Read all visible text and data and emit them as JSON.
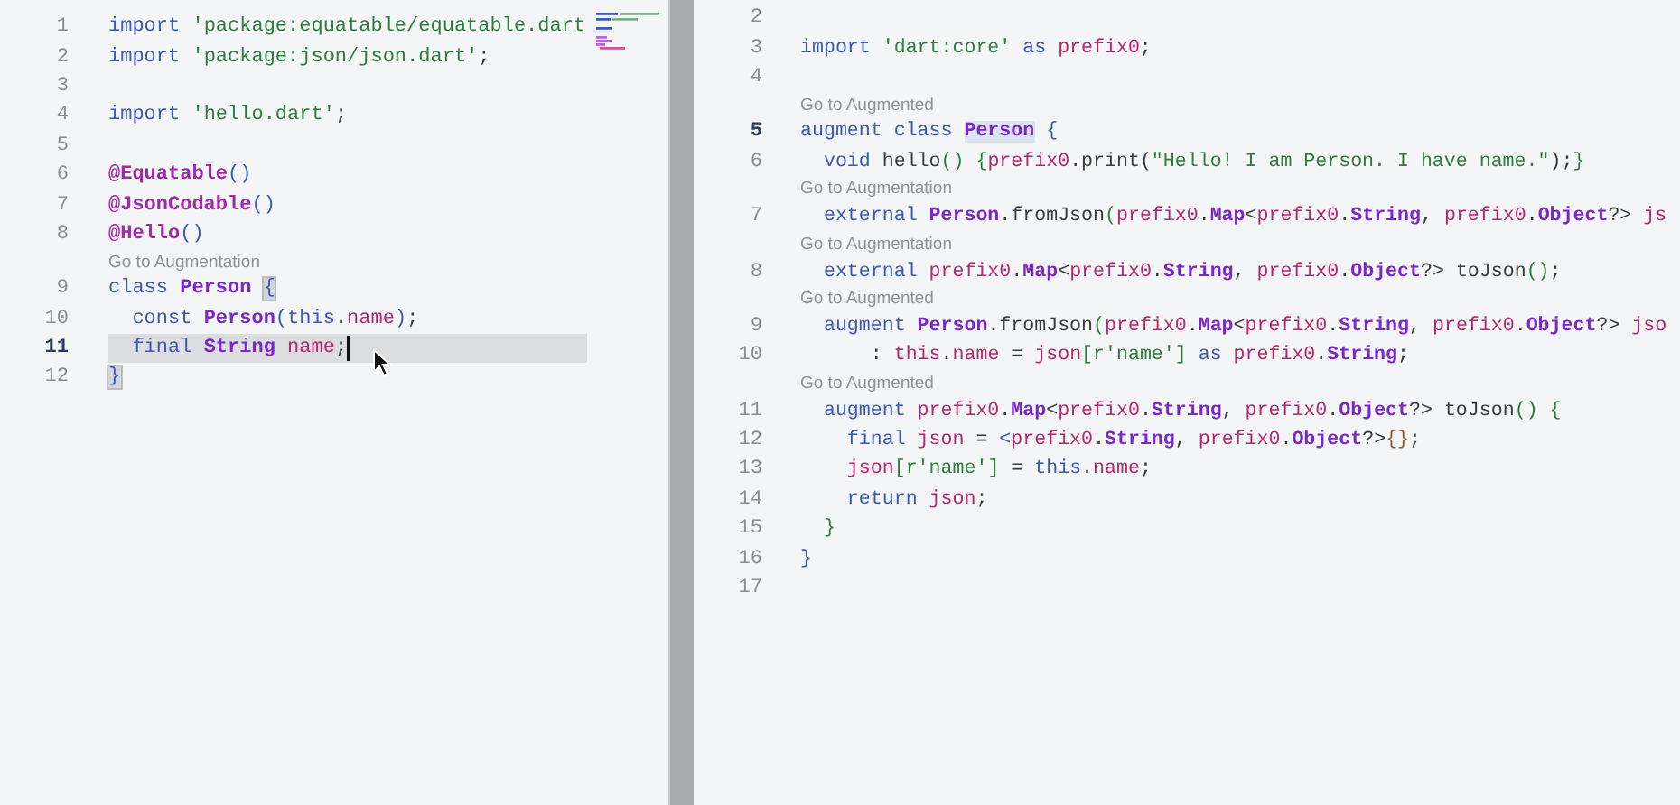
{
  "left_pane": {
    "lines": [
      {
        "kind": "code",
        "number": "1",
        "current": false,
        "highlighted": false,
        "caret": false,
        "tokens": [
          {
            "text": "import ",
            "kind": "kw"
          },
          {
            "text": "'package:equatable/equatable.dart",
            "kind": "str"
          }
        ]
      },
      {
        "kind": "code",
        "number": "2",
        "current": false,
        "highlighted": false,
        "caret": false,
        "tokens": [
          {
            "text": "import ",
            "kind": "kw"
          },
          {
            "text": "'package:json/json.dart'",
            "kind": "str"
          },
          {
            "text": ";",
            "kind": "p"
          }
        ]
      },
      {
        "kind": "code",
        "number": "3",
        "current": false,
        "highlighted": false,
        "caret": false
      },
      {
        "kind": "code",
        "number": "4",
        "current": false,
        "highlighted": false,
        "caret": false,
        "tokens": [
          {
            "text": "import ",
            "kind": "kw"
          },
          {
            "text": "'hello.dart'",
            "kind": "str"
          },
          {
            "text": ";",
            "kind": "p"
          }
        ]
      },
      {
        "kind": "code",
        "number": "5",
        "current": false,
        "highlighted": false,
        "caret": false
      },
      {
        "kind": "code",
        "number": "6",
        "current": false,
        "highlighted": false,
        "caret": false,
        "tokens": [
          {
            "text": "@Equatable",
            "kind": "ann"
          },
          {
            "text": "()",
            "kind": "brk"
          }
        ]
      },
      {
        "kind": "code",
        "number": "7",
        "current": false,
        "highlighted": false,
        "caret": false,
        "tokens": [
          {
            "text": "@JsonCodable",
            "kind": "ann"
          },
          {
            "text": "()",
            "kind": "brk"
          }
        ]
      },
      {
        "kind": "code",
        "number": "8",
        "current": false,
        "highlighted": false,
        "caret": false,
        "tokens": [
          {
            "text": "@Hello",
            "kind": "ann"
          },
          {
            "text": "()",
            "kind": "brk"
          }
        ]
      },
      {
        "kind": "lens",
        "text": "Go to Augmentation"
      },
      {
        "kind": "code",
        "number": "9",
        "current": false,
        "highlighted": false,
        "caret": false,
        "tokens": [
          {
            "text": "class ",
            "kind": "kw"
          },
          {
            "text": "Person ",
            "kind": "type"
          },
          {
            "text": "{",
            "kind": "brk_match"
          }
        ]
      },
      {
        "kind": "code",
        "number": "10",
        "current": false,
        "highlighted": false,
        "caret": false,
        "tokens": [
          {
            "text": "  const ",
            "kind": "kw"
          },
          {
            "text": "Person",
            "kind": "type"
          },
          {
            "text": "(",
            "kind": "brk"
          },
          {
            "text": "this",
            "kind": "kw"
          },
          {
            "text": ".",
            "kind": "p"
          },
          {
            "text": "name",
            "kind": "var"
          },
          {
            "text": ")",
            "kind": "brk"
          },
          {
            "text": ";",
            "kind": "p"
          }
        ]
      },
      {
        "kind": "code",
        "number": "11",
        "current": true,
        "highlighted": true,
        "caret": true,
        "tokens": [
          {
            "text": "  final ",
            "kind": "kw"
          },
          {
            "text": "String",
            "kind": "type"
          },
          {
            "text": " name",
            "kind": "var"
          },
          {
            "text": ";",
            "kind": "p"
          }
        ]
      },
      {
        "kind": "code",
        "number": "12",
        "current": false,
        "highlighted": false,
        "caret": false,
        "tokens": [
          {
            "text": "}",
            "kind": "brk_match"
          }
        ]
      }
    ]
  },
  "right_pane": {
    "lines": [
      {
        "kind": "code",
        "number": "2",
        "current": false
      },
      {
        "kind": "code",
        "number": "3",
        "current": false,
        "tokens": [
          {
            "text": "import ",
            "kind": "kw"
          },
          {
            "text": "'dart:core'",
            "kind": "str"
          },
          {
            "text": " as ",
            "kind": "kw"
          },
          {
            "text": "prefix0",
            "kind": "var"
          },
          {
            "text": ";",
            "kind": "p"
          }
        ]
      },
      {
        "kind": "code",
        "number": "4",
        "current": false
      },
      {
        "kind": "lens",
        "text": "Go to Augmented"
      },
      {
        "kind": "code",
        "number": "5",
        "current": true,
        "tokens": [
          {
            "text": "augment class ",
            "kind": "kw"
          },
          {
            "text": "Person",
            "kind": "type_match"
          },
          {
            "text": " {",
            "kind": "brk"
          }
        ]
      },
      {
        "kind": "code",
        "number": "6",
        "current": false,
        "tokens": [
          {
            "text": "  void",
            "kind": "kw"
          },
          {
            "text": " hello",
            "kind": "p"
          },
          {
            "text": "() {",
            "kind": "brk2"
          },
          {
            "text": "prefix0",
            "kind": "var"
          },
          {
            "text": ".print(",
            "kind": "p"
          },
          {
            "text": "\"Hello! I am Person. I have name.\"",
            "kind": "str"
          },
          {
            "text": ");",
            "kind": "p"
          },
          {
            "text": "}",
            "kind": "brk2"
          }
        ]
      },
      {
        "kind": "lens",
        "text": "Go to Augmentation"
      },
      {
        "kind": "code",
        "number": "7",
        "current": false,
        "tokens": [
          {
            "text": "  external ",
            "kind": "kw"
          },
          {
            "text": "Person",
            "kind": "type"
          },
          {
            "text": ".fromJson",
            "kind": "p"
          },
          {
            "text": "(",
            "kind": "brk2"
          },
          {
            "text": "prefix0",
            "kind": "var"
          },
          {
            "text": ".",
            "kind": "p"
          },
          {
            "text": "Map",
            "kind": "type"
          },
          {
            "text": "<",
            "kind": "p"
          },
          {
            "text": "prefix0",
            "kind": "var"
          },
          {
            "text": ".",
            "kind": "p"
          },
          {
            "text": "String",
            "kind": "type"
          },
          {
            "text": ", ",
            "kind": "p"
          },
          {
            "text": "prefix0",
            "kind": "var"
          },
          {
            "text": ".",
            "kind": "p"
          },
          {
            "text": "Object",
            "kind": "type"
          },
          {
            "text": "?> ",
            "kind": "p"
          },
          {
            "text": "js",
            "kind": "var"
          }
        ]
      },
      {
        "kind": "lens",
        "text": "Go to Augmentation"
      },
      {
        "kind": "code",
        "number": "8",
        "current": false,
        "tokens": [
          {
            "text": "  external ",
            "kind": "kw"
          },
          {
            "text": "prefix0",
            "kind": "var"
          },
          {
            "text": ".",
            "kind": "p"
          },
          {
            "text": "Map",
            "kind": "type"
          },
          {
            "text": "<",
            "kind": "p"
          },
          {
            "text": "prefix0",
            "kind": "var"
          },
          {
            "text": ".",
            "kind": "p"
          },
          {
            "text": "String",
            "kind": "type"
          },
          {
            "text": ", ",
            "kind": "p"
          },
          {
            "text": "prefix0",
            "kind": "var"
          },
          {
            "text": ".",
            "kind": "p"
          },
          {
            "text": "Object",
            "kind": "type"
          },
          {
            "text": "?> toJson",
            "kind": "p"
          },
          {
            "text": "()",
            "kind": "brk2"
          },
          {
            "text": ";",
            "kind": "p"
          }
        ]
      },
      {
        "kind": "lens",
        "text": "Go to Augmented"
      },
      {
        "kind": "code",
        "number": "9",
        "current": false,
        "tokens": [
          {
            "text": "  augment ",
            "kind": "kw"
          },
          {
            "text": "Person",
            "kind": "type"
          },
          {
            "text": ".fromJson",
            "kind": "p"
          },
          {
            "text": "(",
            "kind": "brk2"
          },
          {
            "text": "prefix0",
            "kind": "var"
          },
          {
            "text": ".",
            "kind": "p"
          },
          {
            "text": "Map",
            "kind": "type"
          },
          {
            "text": "<",
            "kind": "p"
          },
          {
            "text": "prefix0",
            "kind": "var"
          },
          {
            "text": ".",
            "kind": "p"
          },
          {
            "text": "String",
            "kind": "type"
          },
          {
            "text": ", ",
            "kind": "p"
          },
          {
            "text": "prefix0",
            "kind": "var"
          },
          {
            "text": ".",
            "kind": "p"
          },
          {
            "text": "Object",
            "kind": "type"
          },
          {
            "text": "?> ",
            "kind": "p"
          },
          {
            "text": "jso",
            "kind": "var"
          }
        ]
      },
      {
        "kind": "code",
        "number": "10",
        "current": false,
        "tokens": [
          {
            "text": "      : ",
            "kind": "p"
          },
          {
            "text": "this",
            "kind": "var"
          },
          {
            "text": ".",
            "kind": "p"
          },
          {
            "text": "name",
            "kind": "var"
          },
          {
            "text": " = ",
            "kind": "p"
          },
          {
            "text": "json",
            "kind": "var"
          },
          {
            "text": "[",
            "kind": "brk2"
          },
          {
            "text": "r'name'",
            "kind": "str"
          },
          {
            "text": "]",
            "kind": "brk2"
          },
          {
            "text": " as ",
            "kind": "kw"
          },
          {
            "text": "prefix0",
            "kind": "var"
          },
          {
            "text": ".",
            "kind": "p"
          },
          {
            "text": "String",
            "kind": "type"
          },
          {
            "text": ";",
            "kind": "p"
          }
        ]
      },
      {
        "kind": "lens",
        "text": "Go to Augmented"
      },
      {
        "kind": "code",
        "number": "11",
        "current": false,
        "tokens": [
          {
            "text": "  augment ",
            "kind": "kw"
          },
          {
            "text": "prefix0",
            "kind": "var"
          },
          {
            "text": ".",
            "kind": "p"
          },
          {
            "text": "Map",
            "kind": "type"
          },
          {
            "text": "<",
            "kind": "p"
          },
          {
            "text": "prefix0",
            "kind": "var"
          },
          {
            "text": ".",
            "kind": "p"
          },
          {
            "text": "String",
            "kind": "type"
          },
          {
            "text": ", ",
            "kind": "p"
          },
          {
            "text": "prefix0",
            "kind": "var"
          },
          {
            "text": ".",
            "kind": "p"
          },
          {
            "text": "Object",
            "kind": "type"
          },
          {
            "text": "?> toJson",
            "kind": "p"
          },
          {
            "text": "() {",
            "kind": "brk2"
          }
        ]
      },
      {
        "kind": "code",
        "number": "12",
        "current": false,
        "tokens": [
          {
            "text": "    final ",
            "kind": "kw"
          },
          {
            "text": "json",
            "kind": "var"
          },
          {
            "text": " = ",
            "kind": "p"
          },
          {
            "text": "<",
            "kind": "kw"
          },
          {
            "text": "prefix0",
            "kind": "var"
          },
          {
            "text": ".",
            "kind": "p"
          },
          {
            "text": "String",
            "kind": "type"
          },
          {
            "text": ", ",
            "kind": "p"
          },
          {
            "text": "prefix0",
            "kind": "var"
          },
          {
            "text": ".",
            "kind": "p"
          },
          {
            "text": "Object",
            "kind": "type"
          },
          {
            "text": "?>",
            "kind": "p"
          },
          {
            "text": "{}",
            "kind": "brk3"
          },
          {
            "text": ";",
            "kind": "p"
          }
        ]
      },
      {
        "kind": "code",
        "number": "13",
        "current": false,
        "tokens": [
          {
            "text": "    json",
            "kind": "var"
          },
          {
            "text": "[",
            "kind": "brk2"
          },
          {
            "text": "r'name'",
            "kind": "str"
          },
          {
            "text": "]",
            "kind": "brk2"
          },
          {
            "text": " = ",
            "kind": "p"
          },
          {
            "text": "this",
            "kind": "kw"
          },
          {
            "text": ".",
            "kind": "p"
          },
          {
            "text": "name",
            "kind": "var"
          },
          {
            "text": ";",
            "kind": "p"
          }
        ]
      },
      {
        "kind": "code",
        "number": "14",
        "current": false,
        "tokens": [
          {
            "text": "    return ",
            "kind": "kw"
          },
          {
            "text": "json",
            "kind": "var"
          },
          {
            "text": ";",
            "kind": "p"
          }
        ]
      },
      {
        "kind": "code",
        "number": "15",
        "current": false,
        "tokens": [
          {
            "text": "  }",
            "kind": "brk2"
          }
        ]
      },
      {
        "kind": "code",
        "number": "16",
        "current": false,
        "tokens": [
          {
            "text": "}",
            "kind": "brk"
          }
        ]
      },
      {
        "kind": "code",
        "number": "17",
        "current": false
      }
    ]
  }
}
